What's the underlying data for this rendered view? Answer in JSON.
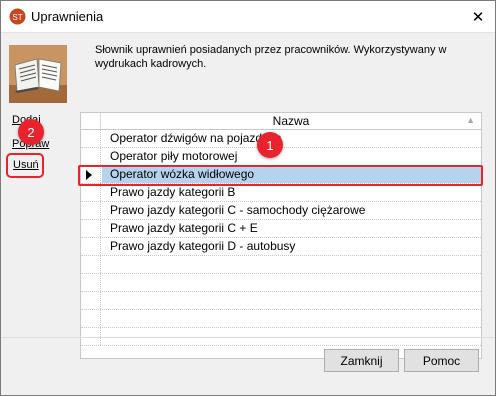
{
  "window": {
    "title": "Uprawnienia",
    "close_glyph": "✕",
    "app_icon": "app-logo-icon"
  },
  "description": "Słownik uprawnień posiadanych przez pracowników. Wykorzystywany w wydrukach kadrowych.",
  "actions": {
    "add": "Dodaj",
    "edit": "Popraw",
    "delete": "Usuń"
  },
  "grid": {
    "column_header": "Nazwa",
    "sort_glyph": "▲",
    "selected_index": 2,
    "rows": [
      "Operator dźwigów na pojazdach",
      "Operator piły motorowej",
      "Operator wózka widłowego",
      "Prawo jazdy kategorii B",
      "Prawo jazdy kategorii C - samochody ciężarowe",
      "Prawo jazdy kategorii C + E",
      "Prawo jazdy kategorii D - autobusy",
      "",
      "",
      "",
      "",
      ""
    ]
  },
  "annotations": {
    "badge_1": "1",
    "badge_2": "2",
    "highlight_color": "#e8232d"
  },
  "buttons": {
    "close": "Zamknij",
    "help": "Pomoc"
  },
  "colors": {
    "selection": "#b5d3ef",
    "window_bg": "#f0f0f0"
  }
}
